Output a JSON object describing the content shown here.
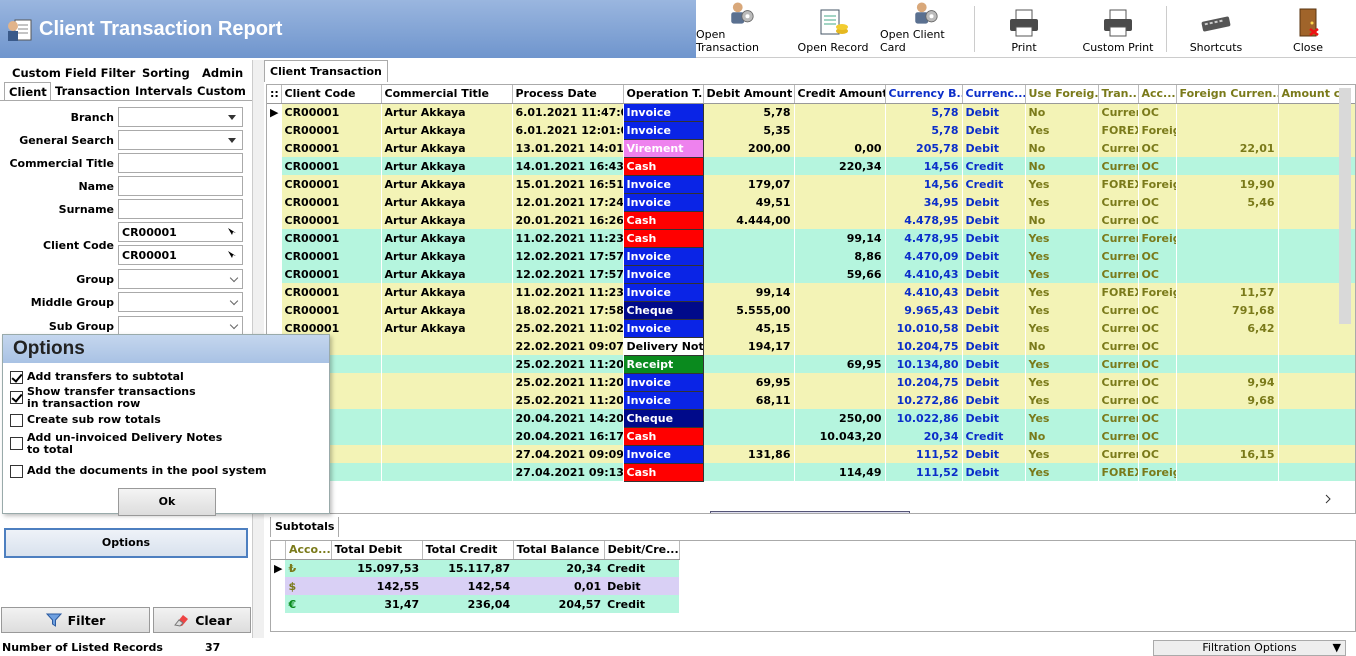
{
  "app": {
    "title": "Client Transaction Report"
  },
  "toolbar": [
    {
      "label": "Open Transaction",
      "icon": "person-gear-icon"
    },
    {
      "label": "Open Record",
      "icon": "document-coins-icon"
    },
    {
      "label": "Open Client Card",
      "icon": "person-gear-icon"
    },
    {
      "label": "Print",
      "icon": "printer-icon"
    },
    {
      "label": "Custom Print",
      "icon": "printer-icon"
    },
    {
      "label": "Shortcuts",
      "icon": "keyboard-icon"
    },
    {
      "label": "Close",
      "icon": "door-exit-icon"
    }
  ],
  "left": {
    "tabs_row1": [
      "Custom Field Filter",
      "Sorting",
      "Admin"
    ],
    "tabs_row2": [
      "Client",
      "Transaction",
      "Intervals",
      "Custom"
    ],
    "fields": {
      "branch": "Branch",
      "general_search": "General Search",
      "commercial_title": "Commercial Title",
      "name": "Name",
      "surname": "Surname",
      "client_code": "Client Code",
      "client_code_from": "CR00001",
      "client_code_to": "CR00001",
      "group": "Group",
      "middle_group": "Middle Group",
      "sub_group": "Sub Group"
    },
    "options_button": "Options",
    "filter_button": "Filter",
    "clear_button": "Clear"
  },
  "options": {
    "title": "Options",
    "items": [
      {
        "label": "Add transfers to subtotal",
        "checked": true
      },
      {
        "label": "Show transfer transactions in transaction row",
        "checked": true
      },
      {
        "label": "Create sub row totals",
        "checked": false
      },
      {
        "label": "Add un-invoiced Delivery Notes to total",
        "checked": false
      },
      {
        "label": "Add the documents in the pool system",
        "checked": false
      }
    ],
    "ok": "Ok"
  },
  "main": {
    "tab": "Client Transaction",
    "columns": [
      "Client Code",
      "Commercial Title",
      "Process Date",
      "Operation T...",
      "Debit Amount",
      "Credit Amount",
      "Currency B...",
      "Currenc...",
      "Use Foreig...",
      "Tran...",
      "Acc...",
      "Foreign Curren...",
      "Amount c"
    ],
    "rows": [
      [
        "CR00001",
        "Artur Akkaya",
        "6.01.2021 11:47:07",
        "Invoice",
        "5,78",
        "",
        "5,78",
        "Debit",
        "No",
        "Curren",
        "OC",
        ""
      ],
      [
        "CR00001",
        "Artur Akkaya",
        "6.01.2021 12:01:08",
        "Invoice",
        "5,35",
        "",
        "5,78",
        "Debit",
        "Yes",
        "FOREX",
        "Foreign",
        ""
      ],
      [
        "CR00001",
        "Artur Akkaya",
        "13.01.2021 14:01:36",
        "Virement",
        "200,00",
        "0,00",
        "205,78",
        "Debit",
        "No",
        "Curren",
        "OC",
        "22,01"
      ],
      [
        "CR00001",
        "Artur Akkaya",
        "14.01.2021 16:43:54",
        "Cash",
        "",
        "220,34",
        "14,56",
        "Credit",
        "No",
        "Curren",
        "OC",
        ""
      ],
      [
        "CR00001",
        "Artur Akkaya",
        "15.01.2021 16:51:33",
        "Invoice",
        "179,07",
        "",
        "14,56",
        "Credit",
        "Yes",
        "FOREX",
        "Foreign",
        "19,90"
      ],
      [
        "CR00001",
        "Artur Akkaya",
        "12.01.2021 17:24:52",
        "Invoice",
        "49,51",
        "",
        "34,95",
        "Debit",
        "Yes",
        "Curren",
        "OC",
        "5,46"
      ],
      [
        "CR00001",
        "Artur Akkaya",
        "20.01.2021 16:26:11",
        "Cash",
        "4.444,00",
        "",
        "4.478,95",
        "Debit",
        "No",
        "Curren",
        "OC",
        ""
      ],
      [
        "CR00001",
        "Artur Akkaya",
        "11.02.2021 11:23:52",
        "Cash",
        "",
        "99,14",
        "4.478,95",
        "Debit",
        "Yes",
        "Curren",
        "Foreign",
        ""
      ],
      [
        "CR00001",
        "Artur Akkaya",
        "12.02.2021 17:57:10",
        "Invoice",
        "",
        "8,86",
        "4.470,09",
        "Debit",
        "Yes",
        "Curren",
        "OC",
        ""
      ],
      [
        "CR00001",
        "Artur Akkaya",
        "12.02.2021 17:57:50",
        "Invoice",
        "",
        "59,66",
        "4.410,43",
        "Debit",
        "Yes",
        "Curren",
        "OC",
        ""
      ],
      [
        "CR00001",
        "Artur Akkaya",
        "11.02.2021 11:23:52",
        "Invoice",
        "99,14",
        "",
        "4.410,43",
        "Debit",
        "Yes",
        "FOREX",
        "Foreign",
        "11,57"
      ],
      [
        "CR00001",
        "Artur Akkaya",
        "18.02.2021 17:58:01",
        "Cheque",
        "5.555,00",
        "",
        "9.965,43",
        "Debit",
        "Yes",
        "Curren",
        "OC",
        "791,68"
      ],
      [
        "CR00001",
        "Artur Akkaya",
        "25.02.2021 11:02:09",
        "Invoice",
        "45,15",
        "",
        "10.010,58",
        "Debit",
        "Yes",
        "Curren",
        "OC",
        "6,42"
      ],
      [
        "",
        "",
        "22.02.2021 09:07:53",
        "Delivery Note",
        "194,17",
        "",
        "10.204,75",
        "Debit",
        "No",
        "Curren",
        "OC",
        ""
      ],
      [
        "",
        "",
        "25.02.2021 11:20:04",
        "Receipt",
        "",
        "69,95",
        "10.134,80",
        "Debit",
        "Yes",
        "Curren",
        "OC",
        ""
      ],
      [
        "",
        "",
        "25.02.2021 11:20:04",
        "Invoice",
        "69,95",
        "",
        "10.204,75",
        "Debit",
        "Yes",
        "Curren",
        "OC",
        "9,94"
      ],
      [
        "",
        "",
        "25.02.2021 11:20:21",
        "Invoice",
        "68,11",
        "",
        "10.272,86",
        "Debit",
        "Yes",
        "Curren",
        "OC",
        "9,68"
      ],
      [
        "",
        "",
        "20.04.2021 14:20:47",
        "Cheque",
        "",
        "250,00",
        "10.022,86",
        "Debit",
        "Yes",
        "Curren",
        "OC",
        ""
      ],
      [
        "",
        "",
        "20.04.2021 16:17:00",
        "Cash",
        "",
        "10.043,20",
        "20,34",
        "Credit",
        "No",
        "Curren",
        "OC",
        ""
      ],
      [
        "",
        "",
        "27.04.2021 09:09:33",
        "Invoice",
        "131,86",
        "",
        "111,52",
        "Debit",
        "Yes",
        "Curren",
        "OC",
        "16,15"
      ],
      [
        "",
        "",
        "27.04.2021 09:13:21",
        "Cash",
        "",
        "114,49",
        "111,52",
        "Debit",
        "Yes",
        "FOREX",
        "Foreign",
        ""
      ]
    ]
  },
  "subtotals": {
    "tab": "Subtotals",
    "columns": [
      "Acco...",
      "Total Debit",
      "Total Credit",
      "Total Balance",
      "Debit/Cre..."
    ],
    "rows": [
      [
        "₺",
        "15.097,53",
        "15.117,87",
        "20,34",
        "Credit"
      ],
      [
        "$",
        "142,55",
        "142,54",
        "0,01",
        "Debit"
      ],
      [
        "€",
        "31,47",
        "236,04",
        "204,57",
        "Credit"
      ]
    ]
  },
  "status": {
    "label": "Number of Listed Records",
    "count": "37",
    "filtration": "Filtration Options"
  },
  "colors": {
    "Invoice": "#0a24e6",
    "Virement": "#ee82ee",
    "Cash": "#ff0000",
    "Cheque": "#000a8a",
    "Receipt": "#0a8a1e",
    "Delivery Note": "#ffffff",
    "rowYellow": "#f3f3b6",
    "rowCyan": "#b5f5de"
  }
}
